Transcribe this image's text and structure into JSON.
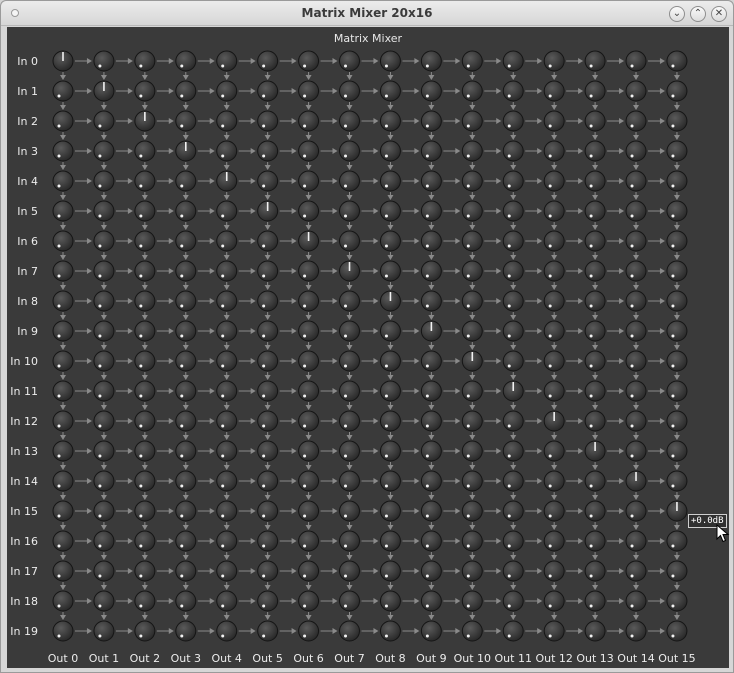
{
  "window": {
    "title": "Matrix Mixer 20x16"
  },
  "panel": {
    "title": "Matrix Mixer"
  },
  "tooltip": "+0.0dB",
  "rows": [
    "In 0",
    "In 1",
    "In 2",
    "In 3",
    "In 4",
    "In 5",
    "In 6",
    "In 7",
    "In 8",
    "In 9",
    "In 10",
    "In 11",
    "In 12",
    "In 13",
    "In 14",
    "In 15",
    "In 16",
    "In 17",
    "In 18",
    "In 19"
  ],
  "columns": [
    "Out 0",
    "Out 1",
    "Out 2",
    "Out 3",
    "Out 4",
    "Out 5",
    "Out 6",
    "Out 7",
    "Out 8",
    "Out 9",
    "Out 10",
    "Out 11",
    "Out 12",
    "Out 13",
    "Out 14",
    "Out 15"
  ],
  "diagonal_gain": "+0.0dB",
  "colors": {
    "panel": "#3a3a3a",
    "label": "#ececec",
    "connector": "#8a8a8a"
  }
}
